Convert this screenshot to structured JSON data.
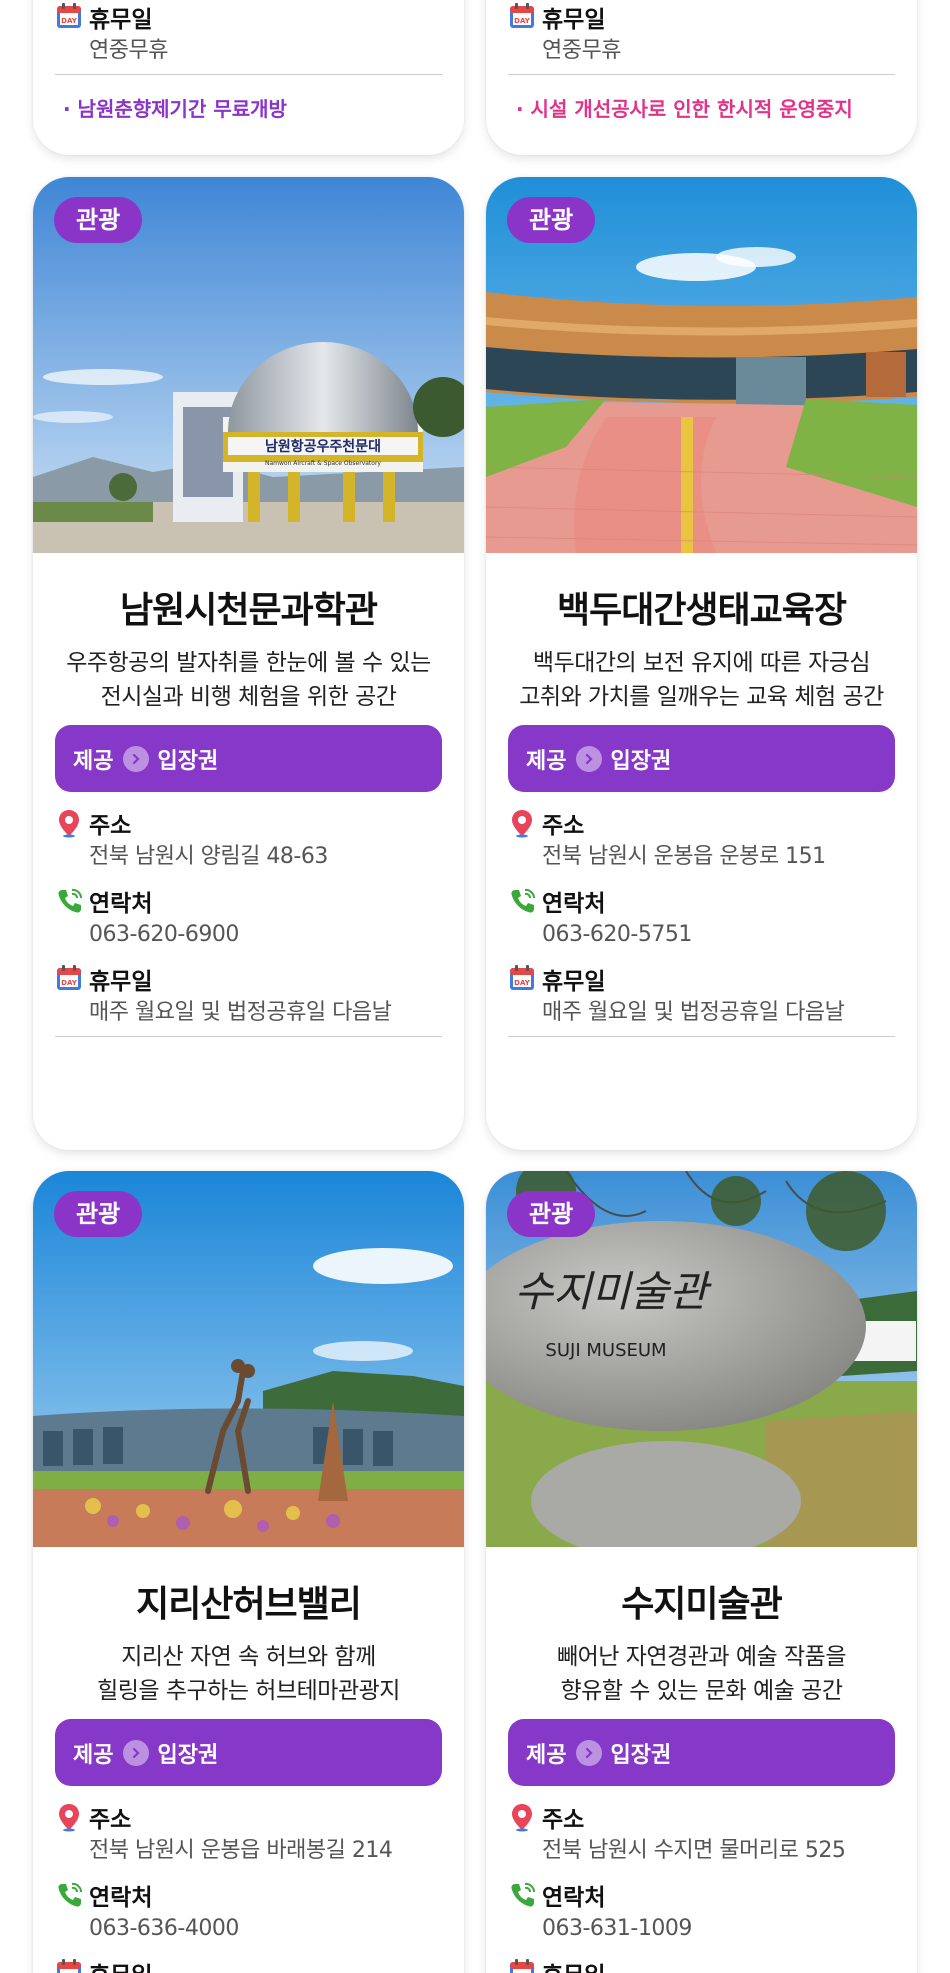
{
  "badge_label": "관광",
  "offer": {
    "prefix": "제공",
    "ticket": "입장권"
  },
  "labels": {
    "address": "주소",
    "phone": "연락처",
    "closed": "휴무일"
  },
  "top_cards": [
    {
      "closed": "연중무휴",
      "notice": "· 남원춘향제기간 무료개방",
      "notice_color": "#8a35c8"
    },
    {
      "closed": "연중무휴",
      "notice": "· 시설 개선공사로 인한 한시적 운영중지",
      "notice_color": "#e0338a"
    }
  ],
  "cards": [
    {
      "title": "남원시천문과학관",
      "desc1": "우주항공의 발자취를 한눈에 볼 수 있는",
      "desc2": "전시실과 비행 체험을 위한 공간",
      "address": "전북 남원시 양림길 48-63",
      "phone": "063-620-6900",
      "closed": "매주 월요일 및 법정공휴일 다음날"
    },
    {
      "title": "백두대간생태교육장",
      "desc1": "백두대간의 보전 유지에 따른 자긍심",
      "desc2": "고취와 가치를 일깨우는 교육 체험 공간",
      "address": "전북 남원시 운봉읍 운봉로 151",
      "phone": "063-620-5751",
      "closed": "매주 월요일 및 법정공휴일 다음날"
    },
    {
      "title": "지리산허브밸리",
      "desc1": "지리산 자연 속 허브와 함께",
      "desc2": "힐링을 추구하는 허브테마관광지",
      "address": "전북 남원시 운봉읍 바래봉길 214",
      "phone": "063-636-4000",
      "closed": "휴무일"
    },
    {
      "title": "수지미술관",
      "desc1": "빼어난 자연경관과 예술 작품을",
      "desc2": "향유할 수 있는 문화 예술 공간",
      "address": "전북 남원시 수지면 물머리로 525",
      "phone": "063-631-1009",
      "closed": "휴무일"
    }
  ],
  "photo_text": {
    "observatory": "남원항공우주천문대",
    "observatory_en": "Namwon Aircraft & Space Observatory",
    "suji_kr": "수지미술관",
    "suji_en": "SUJI MUSEUM"
  },
  "calendar_day": "DAY"
}
